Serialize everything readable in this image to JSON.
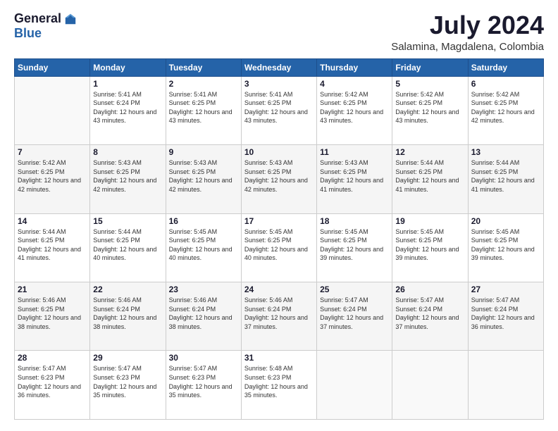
{
  "header": {
    "logo_general": "General",
    "logo_blue": "Blue",
    "month_title": "July 2024",
    "location": "Salamina, Magdalena, Colombia"
  },
  "weekdays": [
    "Sunday",
    "Monday",
    "Tuesday",
    "Wednesday",
    "Thursday",
    "Friday",
    "Saturday"
  ],
  "weeks": [
    [
      {
        "day": "",
        "empty": true
      },
      {
        "day": "1",
        "sunrise": "5:41 AM",
        "sunset": "6:24 PM",
        "daylight": "12 hours and 43 minutes."
      },
      {
        "day": "2",
        "sunrise": "5:41 AM",
        "sunset": "6:25 PM",
        "daylight": "12 hours and 43 minutes."
      },
      {
        "day": "3",
        "sunrise": "5:41 AM",
        "sunset": "6:25 PM",
        "daylight": "12 hours and 43 minutes."
      },
      {
        "day": "4",
        "sunrise": "5:42 AM",
        "sunset": "6:25 PM",
        "daylight": "12 hours and 43 minutes."
      },
      {
        "day": "5",
        "sunrise": "5:42 AM",
        "sunset": "6:25 PM",
        "daylight": "12 hours and 43 minutes."
      },
      {
        "day": "6",
        "sunrise": "5:42 AM",
        "sunset": "6:25 PM",
        "daylight": "12 hours and 42 minutes."
      }
    ],
    [
      {
        "day": "7",
        "sunrise": "5:42 AM",
        "sunset": "6:25 PM",
        "daylight": "12 hours and 42 minutes."
      },
      {
        "day": "8",
        "sunrise": "5:43 AM",
        "sunset": "6:25 PM",
        "daylight": "12 hours and 42 minutes."
      },
      {
        "day": "9",
        "sunrise": "5:43 AM",
        "sunset": "6:25 PM",
        "daylight": "12 hours and 42 minutes."
      },
      {
        "day": "10",
        "sunrise": "5:43 AM",
        "sunset": "6:25 PM",
        "daylight": "12 hours and 42 minutes."
      },
      {
        "day": "11",
        "sunrise": "5:43 AM",
        "sunset": "6:25 PM",
        "daylight": "12 hours and 41 minutes."
      },
      {
        "day": "12",
        "sunrise": "5:44 AM",
        "sunset": "6:25 PM",
        "daylight": "12 hours and 41 minutes."
      },
      {
        "day": "13",
        "sunrise": "5:44 AM",
        "sunset": "6:25 PM",
        "daylight": "12 hours and 41 minutes."
      }
    ],
    [
      {
        "day": "14",
        "sunrise": "5:44 AM",
        "sunset": "6:25 PM",
        "daylight": "12 hours and 41 minutes."
      },
      {
        "day": "15",
        "sunrise": "5:44 AM",
        "sunset": "6:25 PM",
        "daylight": "12 hours and 40 minutes."
      },
      {
        "day": "16",
        "sunrise": "5:45 AM",
        "sunset": "6:25 PM",
        "daylight": "12 hours and 40 minutes."
      },
      {
        "day": "17",
        "sunrise": "5:45 AM",
        "sunset": "6:25 PM",
        "daylight": "12 hours and 40 minutes."
      },
      {
        "day": "18",
        "sunrise": "5:45 AM",
        "sunset": "6:25 PM",
        "daylight": "12 hours and 39 minutes."
      },
      {
        "day": "19",
        "sunrise": "5:45 AM",
        "sunset": "6:25 PM",
        "daylight": "12 hours and 39 minutes."
      },
      {
        "day": "20",
        "sunrise": "5:45 AM",
        "sunset": "6:25 PM",
        "daylight": "12 hours and 39 minutes."
      }
    ],
    [
      {
        "day": "21",
        "sunrise": "5:46 AM",
        "sunset": "6:25 PM",
        "daylight": "12 hours and 38 minutes."
      },
      {
        "day": "22",
        "sunrise": "5:46 AM",
        "sunset": "6:24 PM",
        "daylight": "12 hours and 38 minutes."
      },
      {
        "day": "23",
        "sunrise": "5:46 AM",
        "sunset": "6:24 PM",
        "daylight": "12 hours and 38 minutes."
      },
      {
        "day": "24",
        "sunrise": "5:46 AM",
        "sunset": "6:24 PM",
        "daylight": "12 hours and 37 minutes."
      },
      {
        "day": "25",
        "sunrise": "5:47 AM",
        "sunset": "6:24 PM",
        "daylight": "12 hours and 37 minutes."
      },
      {
        "day": "26",
        "sunrise": "5:47 AM",
        "sunset": "6:24 PM",
        "daylight": "12 hours and 37 minutes."
      },
      {
        "day": "27",
        "sunrise": "5:47 AM",
        "sunset": "6:24 PM",
        "daylight": "12 hours and 36 minutes."
      }
    ],
    [
      {
        "day": "28",
        "sunrise": "5:47 AM",
        "sunset": "6:23 PM",
        "daylight": "12 hours and 36 minutes."
      },
      {
        "day": "29",
        "sunrise": "5:47 AM",
        "sunset": "6:23 PM",
        "daylight": "12 hours and 35 minutes."
      },
      {
        "day": "30",
        "sunrise": "5:47 AM",
        "sunset": "6:23 PM",
        "daylight": "12 hours and 35 minutes."
      },
      {
        "day": "31",
        "sunrise": "5:48 AM",
        "sunset": "6:23 PM",
        "daylight": "12 hours and 35 minutes."
      },
      {
        "day": "",
        "empty": true
      },
      {
        "day": "",
        "empty": true
      },
      {
        "day": "",
        "empty": true
      }
    ]
  ]
}
